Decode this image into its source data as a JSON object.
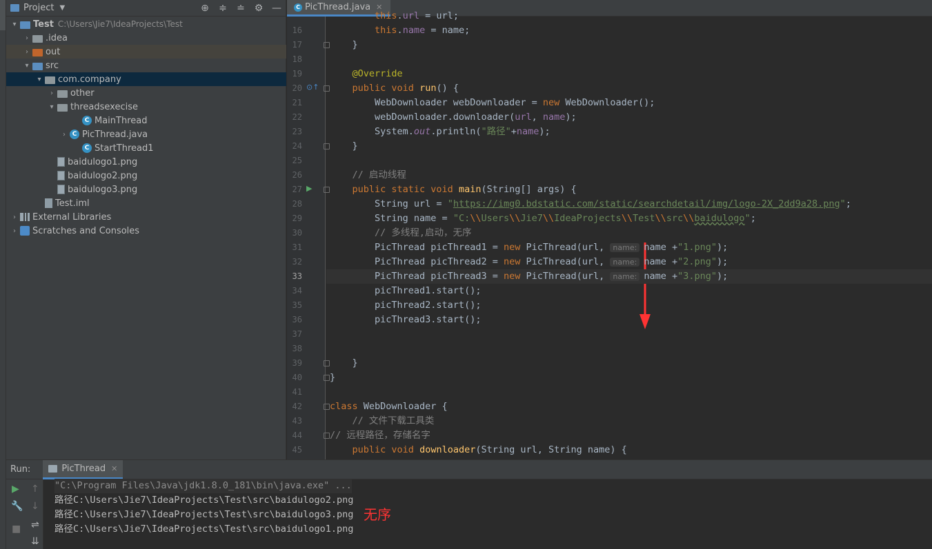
{
  "project_panel": {
    "title": "Project",
    "tree": [
      {
        "label": "Test",
        "path": "C:\\Users\\Jie7\\IdeaProjects\\Test",
        "icon": "module-folder-icon",
        "arrow": "▾"
      },
      {
        "label": ".idea",
        "icon": "folder-icon",
        "arrow": "›"
      },
      {
        "label": "out",
        "icon": "folder-orange-icon",
        "arrow": "›"
      },
      {
        "label": "src",
        "icon": "source-folder-icon",
        "arrow": "▾"
      },
      {
        "label": "com.company",
        "icon": "package-icon",
        "arrow": "▾"
      },
      {
        "label": "other",
        "icon": "package-icon",
        "arrow": "›"
      },
      {
        "label": "threadsexecise",
        "icon": "package-icon",
        "arrow": "▾"
      },
      {
        "label": "MainThread",
        "icon": "class-icon"
      },
      {
        "label": "PicThread.java",
        "icon": "class-icon",
        "arrow": "›"
      },
      {
        "label": "StartThread1",
        "icon": "class-icon"
      },
      {
        "label": "baidulogo1.png",
        "icon": "image-file-icon"
      },
      {
        "label": "baidulogo2.png",
        "icon": "image-file-icon"
      },
      {
        "label": "baidulogo3.png",
        "icon": "image-file-icon"
      },
      {
        "label": "Test.iml",
        "icon": "iml-file-icon"
      },
      {
        "label": "External Libraries",
        "icon": "library-icon",
        "arrow": "›"
      },
      {
        "label": "Scratches and Consoles",
        "icon": "scratches-icon",
        "arrow": "›"
      }
    ]
  },
  "editor": {
    "tab": "PicThread.java",
    "lines": [
      {
        "n": "16",
        "html": "        <span class=\"kw\">this</span>.<span class=\"fld\">name</span> = name;"
      },
      {
        "n": "17",
        "html": "    }"
      },
      {
        "n": "18",
        "html": ""
      },
      {
        "n": "19",
        "html": "    <span class=\"an\">@Override</span>"
      },
      {
        "n": "20",
        "html": "    <span class=\"kw\">public void</span> <span class=\"fn\">run</span>() {"
      },
      {
        "n": "21",
        "html": "        WebDownloader webDownloader = <span class=\"kw\">new</span> WebDownloader();"
      },
      {
        "n": "22",
        "html": "        webDownloader.downloader(<span class=\"fld\">url</span>, <span class=\"fld\">name</span>);"
      },
      {
        "n": "23",
        "html": "        System.<span class=\"fld it\">out</span>.println(<span class=\"str\">\"路径\"</span>+<span class=\"fld\">name</span>);"
      },
      {
        "n": "24",
        "html": "    }"
      },
      {
        "n": "25",
        "html": ""
      },
      {
        "n": "26",
        "html": "    <span class=\"cm\">// 启动线程</span>"
      },
      {
        "n": "27",
        "html": "    <span class=\"kw\">public static void</span> <span class=\"fn\">main</span>(String[] args) {"
      },
      {
        "n": "28",
        "html": "        String url = <span class=\"str\">\"<span class=\"url\">https://img0.bdstatic.com/static/searchdetail/img/logo-2X_2dd9a28.png</span>\"</span>;"
      },
      {
        "n": "29",
        "html": "        String name = <span class=\"str\">\"C:<span class=\"kw\">\\\\</span>Users<span class=\"kw\">\\\\</span>Jie7<span class=\"kw\">\\\\</span>IdeaProjects<span class=\"kw\">\\\\</span>Test<span class=\"kw\">\\\\</span>src<span class=\"kw\">\\\\</span><span class=\"sq\">baidulogo</span>\"</span>;"
      },
      {
        "n": "30",
        "html": "        <span class=\"cm\">// 多线程,启动，无序</span>"
      },
      {
        "n": "31",
        "html": "        PicThread picThread1 = <span class=\"kw\">new</span> PicThread(url, <span class=\"hint\">name:</span>name +<span class=\"str\">\"1.png\"</span>);"
      },
      {
        "n": "32",
        "html": "        PicThread picThread2 = <span class=\"kw\">new</span> PicThread(url, <span class=\"hint\">name:</span>name +<span class=\"str\">\"2.png\"</span>);"
      },
      {
        "n": "33",
        "html": "        PicThread picThread3 = <span class=\"kw\">new</span> PicThread(url, <span class=\"hint\">name:</span>name +<span class=\"str\">\"3.png\"</span>);"
      },
      {
        "n": "34",
        "html": "        picThread1.start();"
      },
      {
        "n": "35",
        "html": "        picThread2.start();"
      },
      {
        "n": "36",
        "html": "        picThread3.start();"
      },
      {
        "n": "37",
        "html": ""
      },
      {
        "n": "38",
        "html": ""
      },
      {
        "n": "39",
        "html": "    }"
      },
      {
        "n": "40",
        "html": "}"
      },
      {
        "n": "41",
        "html": ""
      },
      {
        "n": "42",
        "html": "<span class=\"kw\">class</span> WebDownloader {"
      },
      {
        "n": "43",
        "html": "    <span class=\"cm\">// 文件下载工具类</span>"
      },
      {
        "n": "44",
        "html": "<span class=\"cm\">// 远程路径，存储名字</span>"
      },
      {
        "n": "45",
        "html": "    <span class=\"kw\">public void</span> <span class=\"fn\">downloader</span>(String url, String name) {"
      }
    ]
  },
  "run_panel": {
    "label": "Run:",
    "tab": "PicThread",
    "command": "\"C:\\Program Files\\Java\\jdk1.8.0_181\\bin\\java.exe\" ...",
    "output": [
      "路径C:\\Users\\Jie7\\IdeaProjects\\Test\\src\\baidulogo2.png",
      "路径C:\\Users\\Jie7\\IdeaProjects\\Test\\src\\baidulogo3.png",
      "路径C:\\Users\\Jie7\\IdeaProjects\\Test\\src\\baidulogo1.png"
    ]
  },
  "annotation": {
    "text": "无序",
    "color": "#ff3333"
  }
}
